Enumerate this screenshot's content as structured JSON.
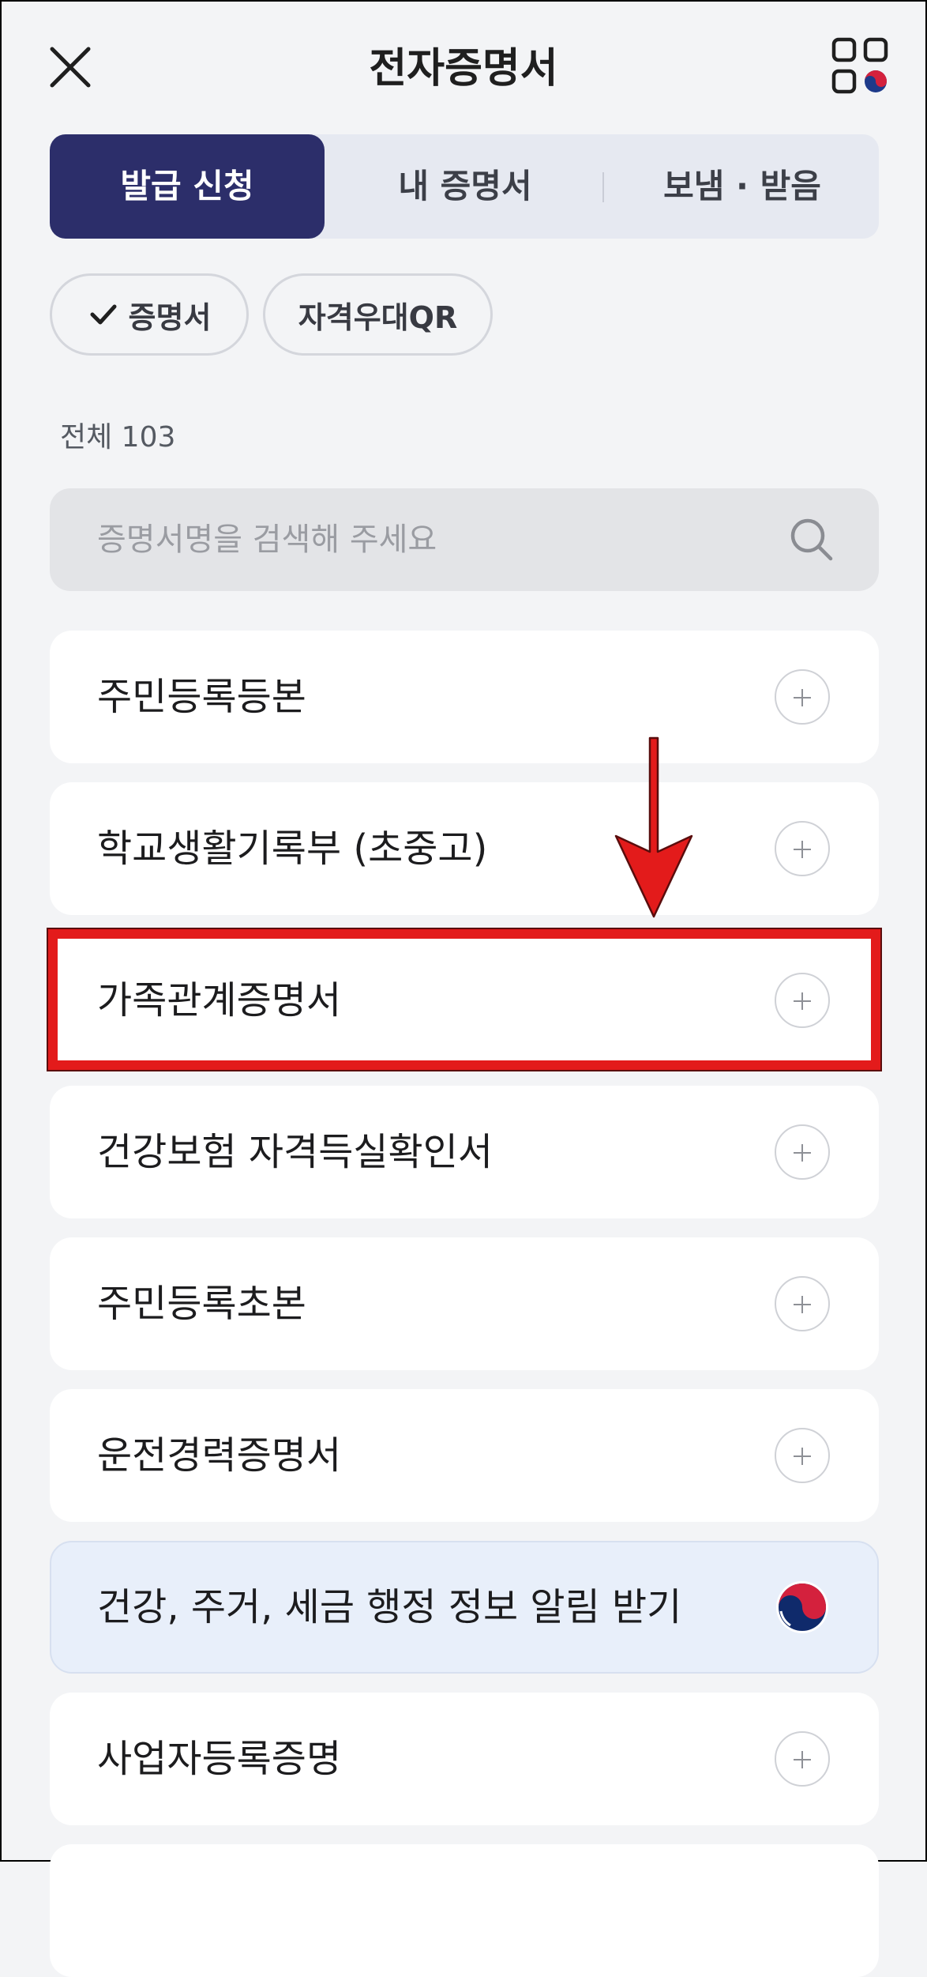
{
  "header": {
    "title": "전자증명서",
    "close_icon": "close-icon",
    "menu_icon": "grid-menu-icon"
  },
  "tabs": [
    {
      "label": "발급 신청",
      "active": true
    },
    {
      "label": "내 증명서",
      "active": false
    },
    {
      "label": "보냄 · 받음",
      "active": false
    }
  ],
  "filters": [
    {
      "label": "증명서",
      "selected": true,
      "icon": "check-icon"
    },
    {
      "label": "자격우대QR",
      "selected": false
    }
  ],
  "count_label": "전체 103",
  "search": {
    "placeholder": "증명서명을 검색해 주세요",
    "value": ""
  },
  "items": [
    {
      "label": "주민등록등본",
      "action_icon": "plus-icon"
    },
    {
      "label": "학교생활기록부 (초중고)",
      "action_icon": "plus-icon"
    },
    {
      "label": "가족관계증명서",
      "action_icon": "plus-icon",
      "highlighted": true
    },
    {
      "label": "건강보험 자격득실확인서",
      "action_icon": "plus-icon"
    },
    {
      "label": "주민등록초본",
      "action_icon": "plus-icon"
    },
    {
      "label": "운전경력증명서",
      "action_icon": "plus-icon"
    },
    {
      "label": "건강, 주거, 세금 행정 정보 알림 받기",
      "action_icon": "gov-emblem-icon"
    },
    {
      "label": "사업자등록증명",
      "action_icon": "plus-icon"
    }
  ],
  "colors": {
    "accent": "#2c2e6a",
    "highlight": "#e31b1b",
    "notice_bg": "#e8effa"
  }
}
